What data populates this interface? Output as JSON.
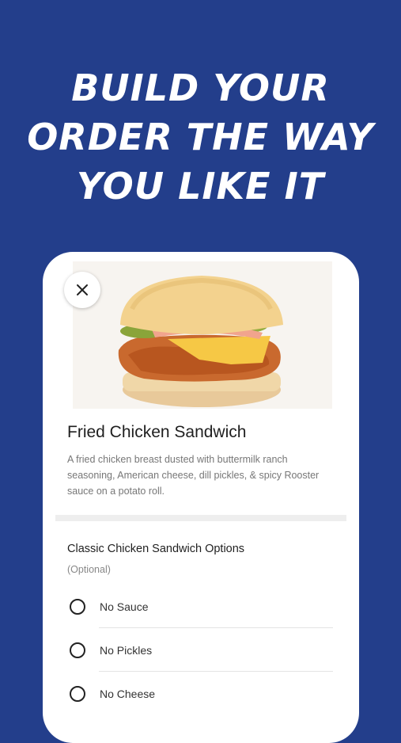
{
  "headline": {
    "line1": "BUILD YOUR",
    "line2": "ORDER THE WAY",
    "line3": "YOU LIKE IT"
  },
  "product": {
    "name": "Fried Chicken Sandwich",
    "description": "A fried chicken breast dusted with buttermilk ranch seasoning, American cheese, dill pickles, & spicy Rooster sauce on a potato roll."
  },
  "options_group": {
    "title": "Classic Chicken Sandwich Options",
    "subtitle": "(Optional)",
    "options": [
      {
        "label": "No Sauce",
        "selected": false
      },
      {
        "label": "No Pickles",
        "selected": false
      },
      {
        "label": "No Cheese",
        "selected": false
      }
    ]
  },
  "icons": {
    "close": "close-icon",
    "radio": "radio-unselected-icon"
  },
  "colors": {
    "background": "#233e8b",
    "card": "#ffffff"
  }
}
